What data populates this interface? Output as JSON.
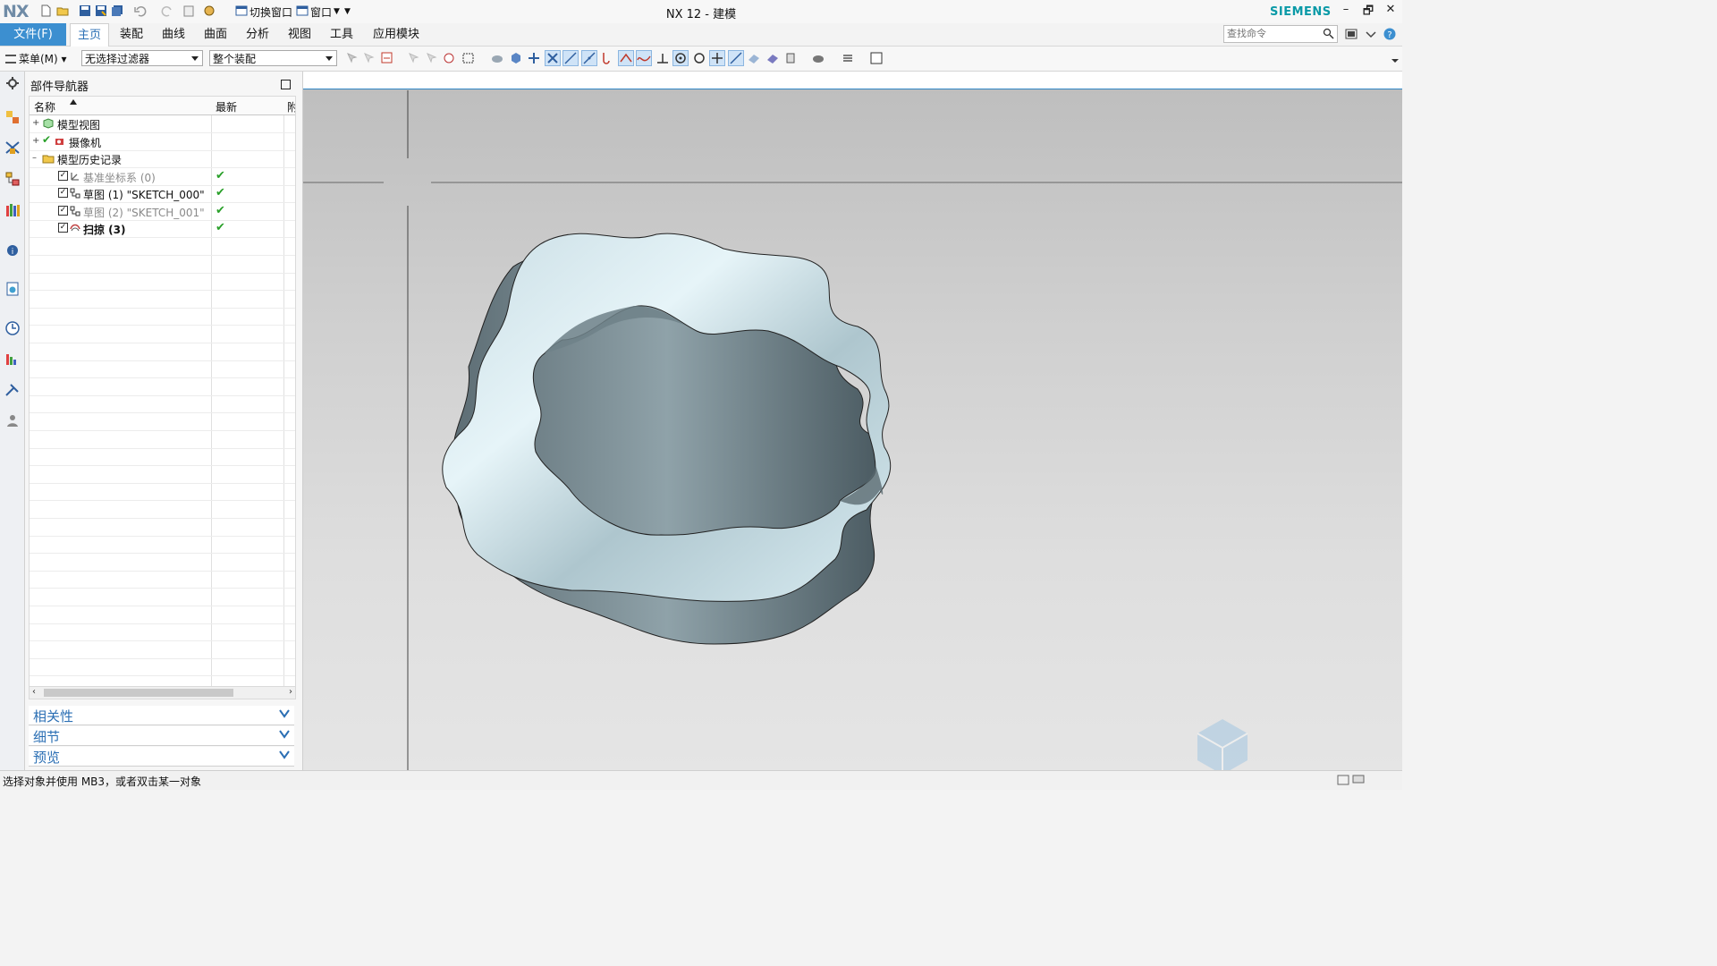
{
  "window": {
    "logo": "NX",
    "title": "NX 12 - 建模",
    "brand": "SIEMENS",
    "quick_access": {
      "switch_window": "切换窗口",
      "window": "窗口"
    },
    "controls": {
      "minimize": "–",
      "restore": "🗗",
      "close": "✕"
    }
  },
  "ribbon": {
    "file_tab": "文件(F)",
    "tabs": [
      "主页",
      "装配",
      "曲线",
      "曲面",
      "分析",
      "视图",
      "工具",
      "应用模块"
    ],
    "active_tab": "主页",
    "search_placeholder": "查找命令"
  },
  "toolbar": {
    "menu_label": "菜单(M)",
    "selection_filter": "无选择过滤器",
    "scope": "整个装配"
  },
  "part_navigator": {
    "title": "部件导航器",
    "columns": {
      "name": "名称",
      "latest": "最新",
      "third": "附"
    },
    "rows": [
      {
        "label": "模型视图",
        "state": "normal",
        "latest": ""
      },
      {
        "label": "摄像机",
        "state": "normal",
        "latest": ""
      },
      {
        "label": "模型历史记录",
        "state": "normal",
        "latest": ""
      },
      {
        "label": "基准坐标系 (0)",
        "state": "dim",
        "latest": "✔"
      },
      {
        "label": "草图 (1) \"SKETCH_000\"",
        "state": "normal",
        "latest": "✔"
      },
      {
        "label": "草图 (2) \"SKETCH_001\"",
        "state": "dim",
        "latest": "✔"
      },
      {
        "label": "扫掠 (3)",
        "state": "bold",
        "latest": "✔"
      }
    ],
    "sections": [
      "相关性",
      "细节",
      "预览"
    ]
  },
  "status": {
    "message": "选择对象并使用 MB3，或者双击某一对象"
  },
  "colors": {
    "accent": "#3c8fd0",
    "brand": "#0a9aa7",
    "check": "#2aa02a",
    "model_light": "#dbeef4",
    "model_dark": "#4a5a61"
  }
}
